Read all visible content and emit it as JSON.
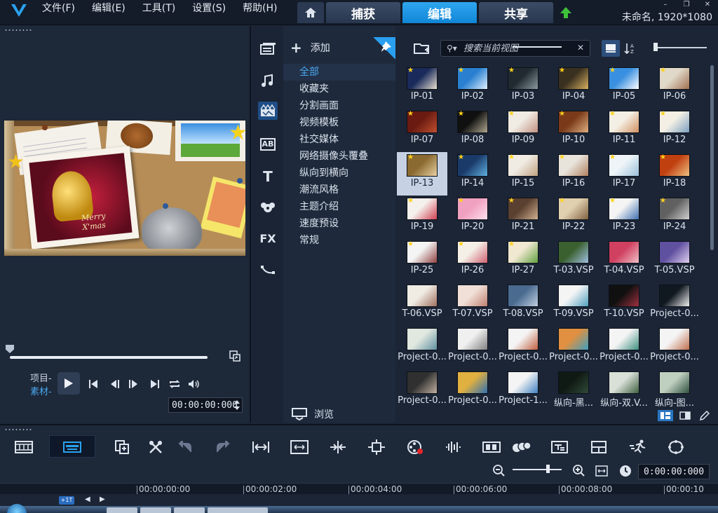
{
  "menu": [
    "文件(F)",
    "编辑(E)",
    "工具(T)",
    "设置(S)",
    "帮助(H)"
  ],
  "tabs": [
    {
      "label": "捕获",
      "active": false
    },
    {
      "label": "编辑",
      "active": true
    },
    {
      "label": "共享",
      "active": false
    }
  ],
  "project_info": "未命名, 1920*1080",
  "accent_color": "#1b8fe0",
  "preview": {
    "mode_project": "项目-",
    "mode_clip": "素材-",
    "timecode": "00:00:00:000",
    "stage_text": "Merry X'mas"
  },
  "library": {
    "add_label": "添加",
    "browse_label": "浏览",
    "categories": [
      {
        "label": "全部",
        "active": true
      },
      {
        "label": "收藏夹",
        "active": false
      },
      {
        "label": "分割画面",
        "active": false
      },
      {
        "label": "视频模板",
        "active": false
      },
      {
        "label": "社交媒体",
        "active": false
      },
      {
        "label": "网络摄像头覆叠",
        "active": false
      },
      {
        "label": "纵向到横向",
        "active": false
      },
      {
        "label": "潮流风格",
        "active": false
      },
      {
        "label": "主题介绍",
        "active": false
      },
      {
        "label": "速度预设",
        "active": false
      },
      {
        "label": "常规",
        "active": false
      }
    ],
    "side_icons": [
      "media-icon",
      "audio-icon",
      "template-icon",
      "title-ab-icon",
      "text-t-icon",
      "transition-icon",
      "fx-icon",
      "path-icon"
    ],
    "side_fx_label": "FX",
    "side_title_label": "AB",
    "side_text_label": "T"
  },
  "search": {
    "placeholder": "搜索当前视图"
  },
  "thumbnails": [
    {
      "label": "IP-01",
      "c1": "#1a2a5a",
      "c2": "#e8e0d0",
      "badge": true
    },
    {
      "label": "IP-02",
      "c1": "#2a80d0",
      "c2": "#dff0ff",
      "badge": true
    },
    {
      "label": "IP-03",
      "c1": "#202a30",
      "c2": "#8a9aa0",
      "badge": true
    },
    {
      "label": "IP-04",
      "c1": "#3a3020",
      "c2": "#d8b060",
      "badge": true
    },
    {
      "label": "IP-05",
      "c1": "#3a90e0",
      "c2": "#ffffff",
      "badge": true
    },
    {
      "label": "IP-06",
      "c1": "#e0d8c8",
      "c2": "#a07050",
      "badge": true
    },
    {
      "label": "IP-07",
      "c1": "#6a1a10",
      "c2": "#c05030",
      "badge": true
    },
    {
      "label": "IP-08",
      "c1": "#101010",
      "c2": "#b0a890",
      "badge": true
    },
    {
      "label": "IP-09",
      "c1": "#f0ece4",
      "c2": "#c09080",
      "badge": true
    },
    {
      "label": "IP-10",
      "c1": "#7a3a1a",
      "c2": "#e0b080",
      "badge": true
    },
    {
      "label": "IP-11",
      "c1": "#f4efe4",
      "c2": "#d09060",
      "badge": true
    },
    {
      "label": "IP-12",
      "c1": "#f4efe4",
      "c2": "#7aa0c0",
      "badge": true
    },
    {
      "label": "IP-13",
      "c1": "#8a6a30",
      "c2": "#e8d0a0",
      "badge": true
    },
    {
      "label": "IP-14",
      "c1": "#1a3a6a",
      "c2": "#60b0e0",
      "badge": true
    },
    {
      "label": "IP-15",
      "c1": "#f0ece4",
      "c2": "#c0a080",
      "badge": true
    },
    {
      "label": "IP-16",
      "c1": "#e8e4dc",
      "c2": "#b08060",
      "badge": true
    },
    {
      "label": "IP-17",
      "c1": "#eef4f8",
      "c2": "#9ac0d8",
      "badge": true
    },
    {
      "label": "IP-18",
      "c1": "#c04010",
      "c2": "#f0c080",
      "badge": true
    },
    {
      "label": "IP-19",
      "c1": "#f4f0ec",
      "c2": "#d04050",
      "badge": true
    },
    {
      "label": "IP-20",
      "c1": "#f0a0c0",
      "c2": "#ffe0ec",
      "badge": true
    },
    {
      "label": "IP-21",
      "c1": "#5a4030",
      "c2": "#d0b090",
      "badge": true
    },
    {
      "label": "IP-22",
      "c1": "#e0d0b0",
      "c2": "#806040",
      "badge": true
    },
    {
      "label": "IP-23",
      "c1": "#f4f4f4",
      "c2": "#4070b0",
      "badge": true
    },
    {
      "label": "IP-24",
      "c1": "#606060",
      "c2": "#d0d0d0",
      "badge": true
    },
    {
      "label": "IP-25",
      "c1": "#f4f4f4",
      "c2": "#904040",
      "badge": true
    },
    {
      "label": "IP-26",
      "c1": "#f4f0e8",
      "c2": "#d06070",
      "badge": true
    },
    {
      "label": "IP-27",
      "c1": "#f0e8d0",
      "c2": "#60a040",
      "badge": true
    },
    {
      "label": "T-03.VSP",
      "c1": "#3a6030",
      "c2": "#a0c0e0",
      "badge": false
    },
    {
      "label": "T-04.VSP",
      "c1": "#d04060",
      "c2": "#f0c0c8",
      "badge": false
    },
    {
      "label": "T-05.VSP",
      "c1": "#6050a0",
      "c2": "#e0d0f0",
      "badge": false
    },
    {
      "label": "T-06.VSP",
      "c1": "#f0ece4",
      "c2": "#a07060",
      "badge": false
    },
    {
      "label": "T-07.VSP",
      "c1": "#f0e0d8",
      "c2": "#c08070",
      "badge": false
    },
    {
      "label": "T-08.VSP",
      "c1": "#4a6a90",
      "c2": "#c0d0e0",
      "badge": false
    },
    {
      "label": "T-09.VSP",
      "c1": "#f4f4f4",
      "c2": "#50a0c0",
      "badge": false
    },
    {
      "label": "T-10.VSP",
      "c1": "#101010",
      "c2": "#a03040",
      "badge": false
    },
    {
      "label": "Project-0...",
      "c1": "#101820",
      "c2": "#f0f0f0",
      "badge": false
    },
    {
      "label": "Project-0...",
      "c1": "#e0e8e0",
      "c2": "#6090a0",
      "badge": false
    },
    {
      "label": "Project-0...",
      "c1": "#f0f0f0",
      "c2": "#808080",
      "badge": false
    },
    {
      "label": "Project-0...",
      "c1": "#f4f4f4",
      "c2": "#c06040",
      "badge": false
    },
    {
      "label": "Project-0...",
      "c1": "#e09040",
      "c2": "#40a0c0",
      "badge": false
    },
    {
      "label": "Project-0...",
      "c1": "#f4f4f4",
      "c2": "#409080",
      "badge": false
    },
    {
      "label": "Project-0...",
      "c1": "#f4f4f4",
      "c2": "#c07050",
      "badge": false
    },
    {
      "label": "Project-0...",
      "c1": "#303030",
      "c2": "#c0b0a0",
      "badge": false
    },
    {
      "label": "Project-0...",
      "c1": "#e0b040",
      "c2": "#3070b0",
      "badge": false
    },
    {
      "label": "Project-1...",
      "c1": "#f4f4f4",
      "c2": "#4080c0",
      "badge": false
    },
    {
      "label": "纵向-黑...",
      "c1": "#101a14",
      "c2": "#304a38",
      "badge": false
    },
    {
      "label": "纵向-双.V...",
      "c1": "#d8e0d8",
      "c2": "#406040",
      "badge": false
    },
    {
      "label": "纵向-图...",
      "c1": "#c0d0c0",
      "c2": "#305040",
      "badge": false
    }
  ],
  "timeline": {
    "timecode": "0:00:00:000",
    "ruler": [
      "00:00:00:00",
      "00:00:02:00",
      "00:00:04:00",
      "00:00:06:00",
      "00:00:08:00",
      "00:00:10"
    ],
    "track_tag": "+1T"
  }
}
